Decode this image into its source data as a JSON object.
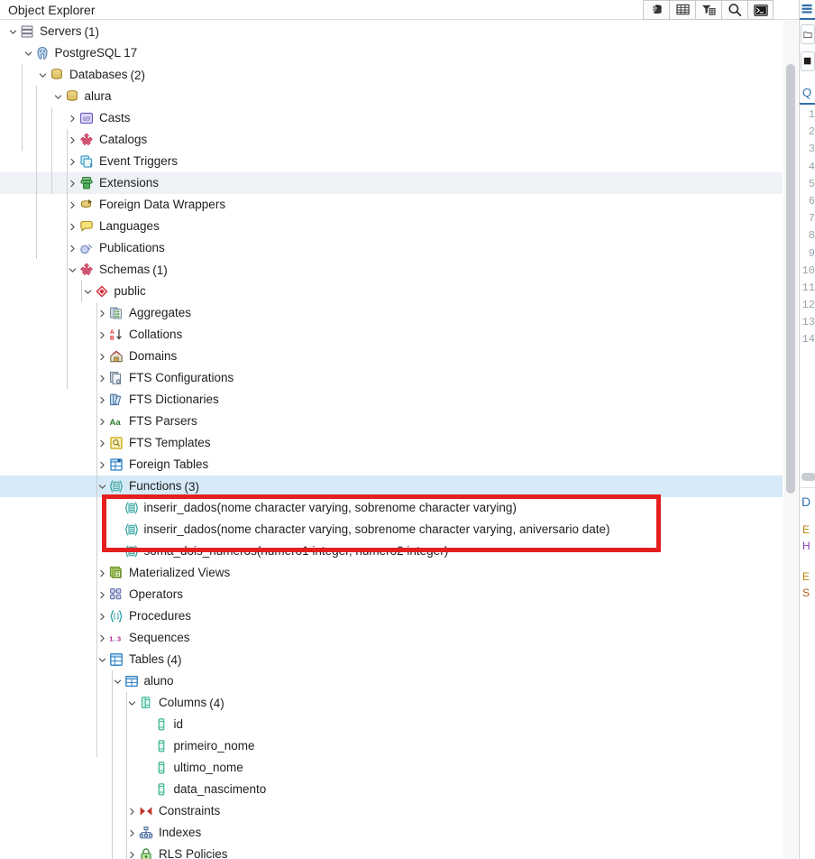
{
  "header": {
    "title": "Object Explorer",
    "toolbar": [
      {
        "name": "object-explorer-refresh-icon",
        "icon": "database-bolt"
      },
      {
        "name": "view-data-grid-icon",
        "icon": "grid"
      },
      {
        "name": "filter-icon",
        "icon": "filter"
      },
      {
        "name": "search-icon",
        "icon": "magnifier"
      },
      {
        "name": "psql-terminal-icon",
        "icon": "terminal"
      }
    ]
  },
  "tree": [
    {
      "depth": 0,
      "twisty": "down",
      "icon": "servers",
      "label": "Servers",
      "count": "(1)",
      "state": "normal"
    },
    {
      "depth": 1,
      "twisty": "down",
      "icon": "postgres",
      "label": "PostgreSQL 17",
      "count": "",
      "state": "normal"
    },
    {
      "depth": 2,
      "twisty": "down",
      "icon": "databases",
      "label": "Databases",
      "count": "(2)",
      "state": "normal"
    },
    {
      "depth": 3,
      "twisty": "down",
      "icon": "database",
      "label": "alura",
      "count": "",
      "state": "normal"
    },
    {
      "depth": 4,
      "twisty": "right",
      "icon": "casts",
      "label": "Casts",
      "count": "",
      "state": "normal"
    },
    {
      "depth": 4,
      "twisty": "right",
      "icon": "catalogs",
      "label": "Catalogs",
      "count": "",
      "state": "normal"
    },
    {
      "depth": 4,
      "twisty": "right",
      "icon": "event-triggers",
      "label": "Event Triggers",
      "count": "",
      "state": "normal"
    },
    {
      "depth": 4,
      "twisty": "right",
      "icon": "extensions",
      "label": "Extensions",
      "count": "",
      "state": "hovered"
    },
    {
      "depth": 4,
      "twisty": "right",
      "icon": "fdw",
      "label": "Foreign Data Wrappers",
      "count": "",
      "state": "normal"
    },
    {
      "depth": 4,
      "twisty": "right",
      "icon": "languages",
      "label": "Languages",
      "count": "",
      "state": "normal"
    },
    {
      "depth": 4,
      "twisty": "right",
      "icon": "publications",
      "label": "Publications",
      "count": "",
      "state": "normal"
    },
    {
      "depth": 4,
      "twisty": "down",
      "icon": "schemas",
      "label": "Schemas",
      "count": "(1)",
      "state": "normal"
    },
    {
      "depth": 5,
      "twisty": "down",
      "icon": "schema",
      "label": "public",
      "count": "",
      "state": "normal"
    },
    {
      "depth": 6,
      "twisty": "right",
      "icon": "aggregates",
      "label": "Aggregates",
      "count": "",
      "state": "normal"
    },
    {
      "depth": 6,
      "twisty": "right",
      "icon": "collations",
      "label": "Collations",
      "count": "",
      "state": "normal"
    },
    {
      "depth": 6,
      "twisty": "right",
      "icon": "domains",
      "label": "Domains",
      "count": "",
      "state": "normal"
    },
    {
      "depth": 6,
      "twisty": "right",
      "icon": "fts-config",
      "label": "FTS Configurations",
      "count": "",
      "state": "normal"
    },
    {
      "depth": 6,
      "twisty": "right",
      "icon": "fts-dict",
      "label": "FTS Dictionaries",
      "count": "",
      "state": "normal"
    },
    {
      "depth": 6,
      "twisty": "right",
      "icon": "fts-parser",
      "label": "FTS Parsers",
      "count": "",
      "state": "normal"
    },
    {
      "depth": 6,
      "twisty": "right",
      "icon": "fts-template",
      "label": "FTS Templates",
      "count": "",
      "state": "normal"
    },
    {
      "depth": 6,
      "twisty": "right",
      "icon": "foreign-tables",
      "label": "Foreign Tables",
      "count": "",
      "state": "normal"
    },
    {
      "depth": 6,
      "twisty": "down",
      "icon": "functions",
      "label": "Functions",
      "count": "(3)",
      "state": "selected"
    },
    {
      "depth": 7,
      "twisty": "none",
      "icon": "function",
      "label": "inserir_dados(nome character varying, sobrenome character varying)",
      "count": "",
      "state": "normal"
    },
    {
      "depth": 7,
      "twisty": "none",
      "icon": "function",
      "label": "inserir_dados(nome character varying, sobrenome character varying, aniversario date)",
      "count": "",
      "state": "normal"
    },
    {
      "depth": 7,
      "twisty": "none",
      "icon": "function",
      "label": "soma_dois_numeros(numero1 integer, numero2 integer)",
      "count": "",
      "state": "normal"
    },
    {
      "depth": 6,
      "twisty": "right",
      "icon": "mat-views",
      "label": "Materialized Views",
      "count": "",
      "state": "normal"
    },
    {
      "depth": 6,
      "twisty": "right",
      "icon": "operators",
      "label": "Operators",
      "count": "",
      "state": "normal"
    },
    {
      "depth": 6,
      "twisty": "right",
      "icon": "procedures",
      "label": "Procedures",
      "count": "",
      "state": "normal"
    },
    {
      "depth": 6,
      "twisty": "right",
      "icon": "sequences",
      "label": "Sequences",
      "count": "",
      "state": "normal"
    },
    {
      "depth": 6,
      "twisty": "down",
      "icon": "tables",
      "label": "Tables",
      "count": "(4)",
      "state": "normal"
    },
    {
      "depth": 7,
      "twisty": "down",
      "icon": "table",
      "label": "aluno",
      "count": "",
      "state": "normal"
    },
    {
      "depth": 8,
      "twisty": "down",
      "icon": "columns",
      "label": "Columns",
      "count": "(4)",
      "state": "normal"
    },
    {
      "depth": 9,
      "twisty": "none",
      "icon": "column",
      "label": "id",
      "count": "",
      "state": "normal"
    },
    {
      "depth": 9,
      "twisty": "none",
      "icon": "column",
      "label": "primeiro_nome",
      "count": "",
      "state": "normal"
    },
    {
      "depth": 9,
      "twisty": "none",
      "icon": "column",
      "label": "ultimo_nome",
      "count": "",
      "state": "normal"
    },
    {
      "depth": 9,
      "twisty": "none",
      "icon": "column",
      "label": "data_nascimento",
      "count": "",
      "state": "normal"
    },
    {
      "depth": 8,
      "twisty": "right",
      "icon": "constraints",
      "label": "Constraints",
      "count": "",
      "state": "normal"
    },
    {
      "depth": 8,
      "twisty": "right",
      "icon": "indexes",
      "label": "Indexes",
      "count": "",
      "state": "normal"
    },
    {
      "depth": 8,
      "twisty": "right",
      "icon": "rls",
      "label": "RLS Policies",
      "count": "",
      "state": "normal"
    }
  ],
  "annotation": {
    "name": "red-highlight-box",
    "color": "#e31f1f",
    "targets": [
      "inserir_dados(nome character varying, sobrenome character varying)",
      "inserir_dados(nome character varying, sobrenome character varying, aniversario date)"
    ]
  },
  "right_panel": {
    "query_tab_label": "Q",
    "line_numbers": [
      "1",
      "2",
      "3",
      "4",
      "5",
      "6",
      "7",
      "8",
      "9",
      "10",
      "11",
      "12",
      "13",
      "14"
    ],
    "section_label": "D",
    "clipped_text": [
      "E",
      "H",
      "E",
      "S"
    ]
  },
  "colors": {
    "selection": "#d6eaf7",
    "hover": "#eef1f5",
    "annotation": "#e31f1f",
    "accent": "#326fa8"
  }
}
